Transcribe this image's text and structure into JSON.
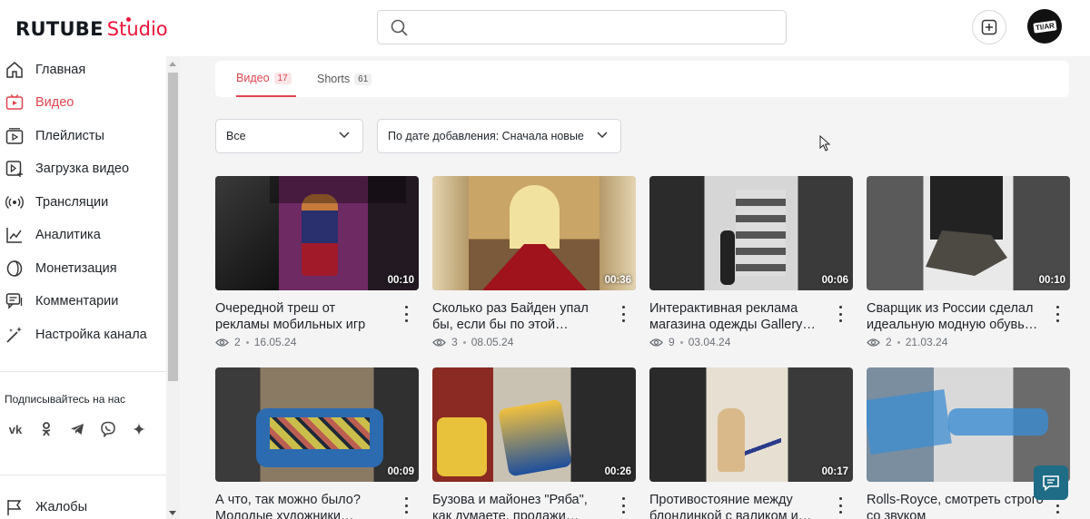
{
  "logo": {
    "brand": "RUTUBE",
    "product": "Studio"
  },
  "search": {
    "placeholder": ""
  },
  "avatar": {
    "text": "TI/AR"
  },
  "sidebar": {
    "items": [
      {
        "label": "Главная",
        "icon": "home-icon"
      },
      {
        "label": "Видео",
        "icon": "video-icon",
        "active": true
      },
      {
        "label": "Плейлисты",
        "icon": "playlist-icon"
      },
      {
        "label": "Загрузка видео",
        "icon": "upload-icon"
      },
      {
        "label": "Трансляции",
        "icon": "broadcast-icon"
      },
      {
        "label": "Аналитика",
        "icon": "analytics-icon"
      },
      {
        "label": "Монетизация",
        "icon": "monetization-icon"
      },
      {
        "label": "Комментарии",
        "icon": "comments-icon"
      },
      {
        "label": "Настройка канала",
        "icon": "settings-wand-icon"
      }
    ],
    "subscribe_label": "Подписывайтесь на нас",
    "socials": [
      "vk-icon",
      "ok-icon",
      "telegram-icon",
      "viber-icon",
      "dzen-icon"
    ],
    "complaints_label": "Жалобы"
  },
  "tabs": [
    {
      "label": "Видео",
      "count": "17",
      "active": true
    },
    {
      "label": "Shorts",
      "count": "61",
      "active": false
    }
  ],
  "filters": {
    "type": "Все",
    "sort": "По дате добавления: Сначала новые"
  },
  "videos": [
    {
      "title": "Очередной треш от рекламы мобильных игр",
      "duration": "00:10",
      "views": "2",
      "date": "16.05.24"
    },
    {
      "title": "Сколько раз Байден упал бы, если бы по этой…",
      "duration": "00:36",
      "views": "3",
      "date": "08.05.24"
    },
    {
      "title": "Интерактивная реклама магазина одежды Gallery…",
      "duration": "00:06",
      "views": "9",
      "date": "03.04.24"
    },
    {
      "title": "Сварщик из России сделал идеальную модную обувь…",
      "duration": "00:10",
      "views": "2",
      "date": "21.03.24"
    },
    {
      "title": "А что, так можно было? Молодые художники…",
      "duration": "00:09",
      "views": "",
      "date": ""
    },
    {
      "title": "Бузова и майонез \"Ряба\", как думаете, продажи…",
      "duration": "00:26",
      "views": "",
      "date": ""
    },
    {
      "title": "Противостояние между блондинкой с валиком и…",
      "duration": "00:17",
      "views": "",
      "date": ""
    },
    {
      "title": "Rolls-Royce, смотреть строго со звуком",
      "duration": "",
      "views": "",
      "date": ""
    }
  ],
  "colors": {
    "accent": "#e0444f",
    "brand_red": "#ed143b",
    "chat": "#1e6c86"
  }
}
